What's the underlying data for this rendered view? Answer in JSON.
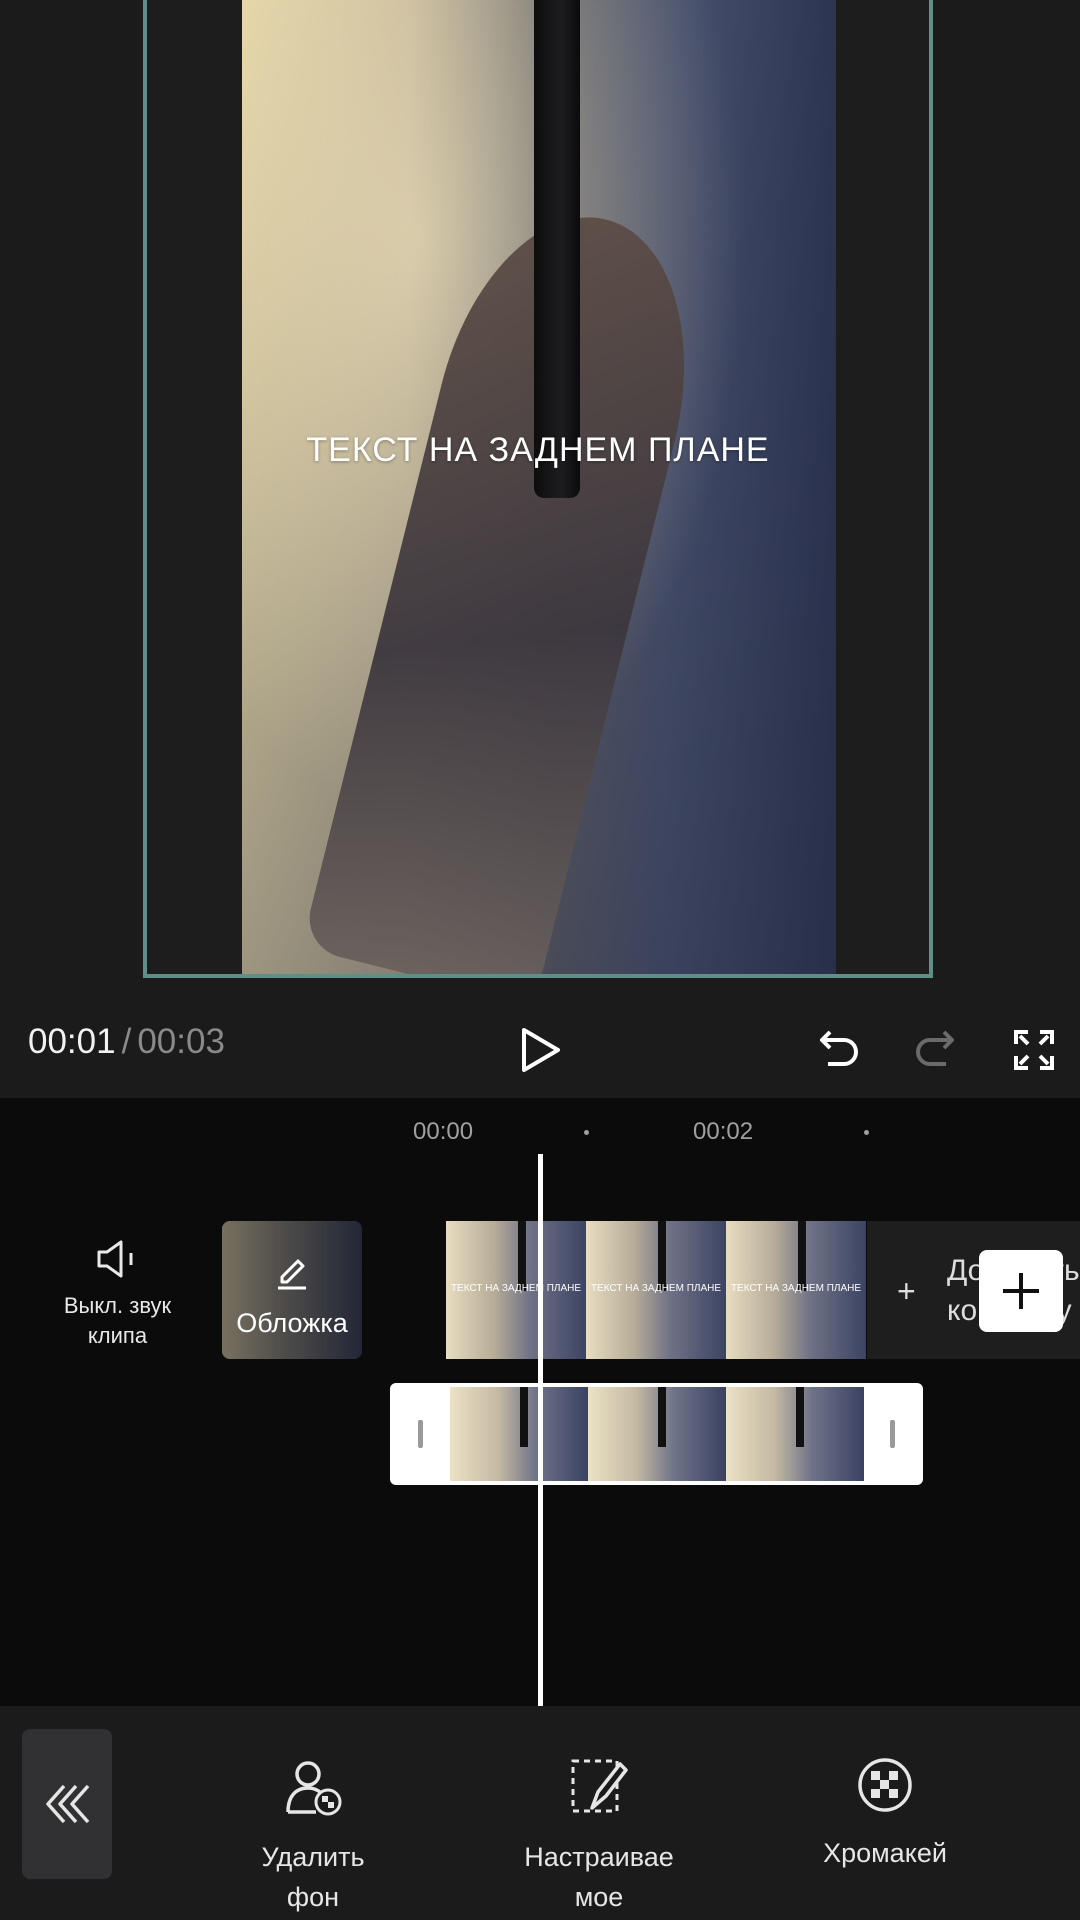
{
  "preview": {
    "overlay_text": "ТЕКСТ НА ЗАДНЕМ ПЛАНЕ"
  },
  "controls": {
    "current_time": "00:01",
    "separator": "/",
    "total_time": "00:03"
  },
  "timeline": {
    "ruler": [
      "00:00",
      "00:02"
    ],
    "mute_label_line1": "Выкл. звук",
    "mute_label_line2": "клипа",
    "cover_label": "Обложка",
    "clip_text": "ТЕКСТ НА ЗАДНЕМ ПЛАНЕ",
    "add_cover_line1": "Добавить",
    "add_cover_line2": "концовку"
  },
  "toolbar": {
    "tools": [
      {
        "line1": "Удалить",
        "line2": "фон"
      },
      {
        "line1": "Настраивае",
        "line2": "мое"
      },
      {
        "line1": "Хромакей",
        "line2": ""
      }
    ]
  },
  "colors": {
    "frame_border": "#5f8f87",
    "background": "#1b1b1c",
    "timeline_bg": "#0b0b0b"
  }
}
